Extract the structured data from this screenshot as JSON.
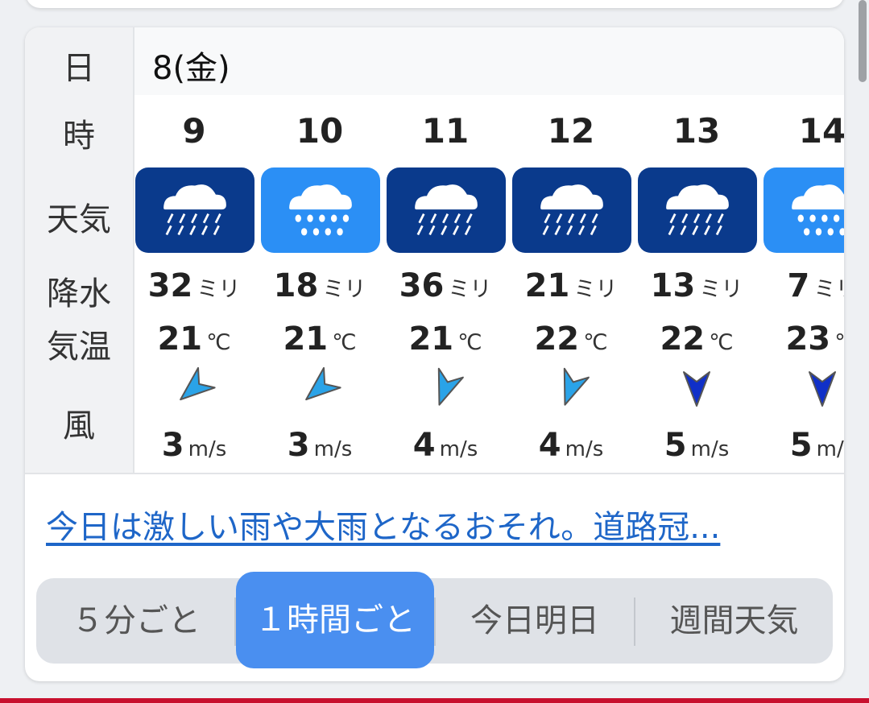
{
  "labels": {
    "day": "日",
    "hour": "時",
    "weather": "天気",
    "precip": "降水",
    "temp": "気温",
    "wind": "風"
  },
  "date": "8(金)",
  "units": {
    "precip": "ミリ",
    "temp": "℃",
    "wind": "m/s"
  },
  "hours": [
    {
      "hour": "9",
      "weather": "heavy-rain-icon",
      "bg": "#0a3a8c",
      "precip": "32",
      "temp": "21",
      "wind": "3",
      "wind_color": "#2aa3e8"
    },
    {
      "hour": "10",
      "weather": "rain-icon",
      "bg": "#2b8ff5",
      "precip": "18",
      "temp": "21",
      "wind": "3",
      "wind_color": "#2aa3e8"
    },
    {
      "hour": "11",
      "weather": "heavy-rain-icon",
      "bg": "#0a3a8c",
      "precip": "36",
      "temp": "21",
      "wind": "4",
      "wind_color": "#2aa3e8"
    },
    {
      "hour": "12",
      "weather": "heavy-rain-icon",
      "bg": "#0a3a8c",
      "precip": "21",
      "temp": "22",
      "wind": "4",
      "wind_color": "#2aa3e8"
    },
    {
      "hour": "13",
      "weather": "heavy-rain-icon",
      "bg": "#0a3a8c",
      "precip": "13",
      "temp": "22",
      "wind": "5",
      "wind_color": "#1030c8"
    },
    {
      "hour": "14",
      "weather": "rain-icon",
      "bg": "#2b8ff5",
      "precip": "7",
      "temp": "23",
      "wind": "5",
      "wind_color": "#1030c8"
    }
  ],
  "headline": "今日は激しい雨や大雨となるおそれ。道路冠...",
  "tabs": [
    "５分ごと",
    "１時間ごと",
    "今日明日",
    "週間天気"
  ],
  "active_tab": "１時間ごと"
}
